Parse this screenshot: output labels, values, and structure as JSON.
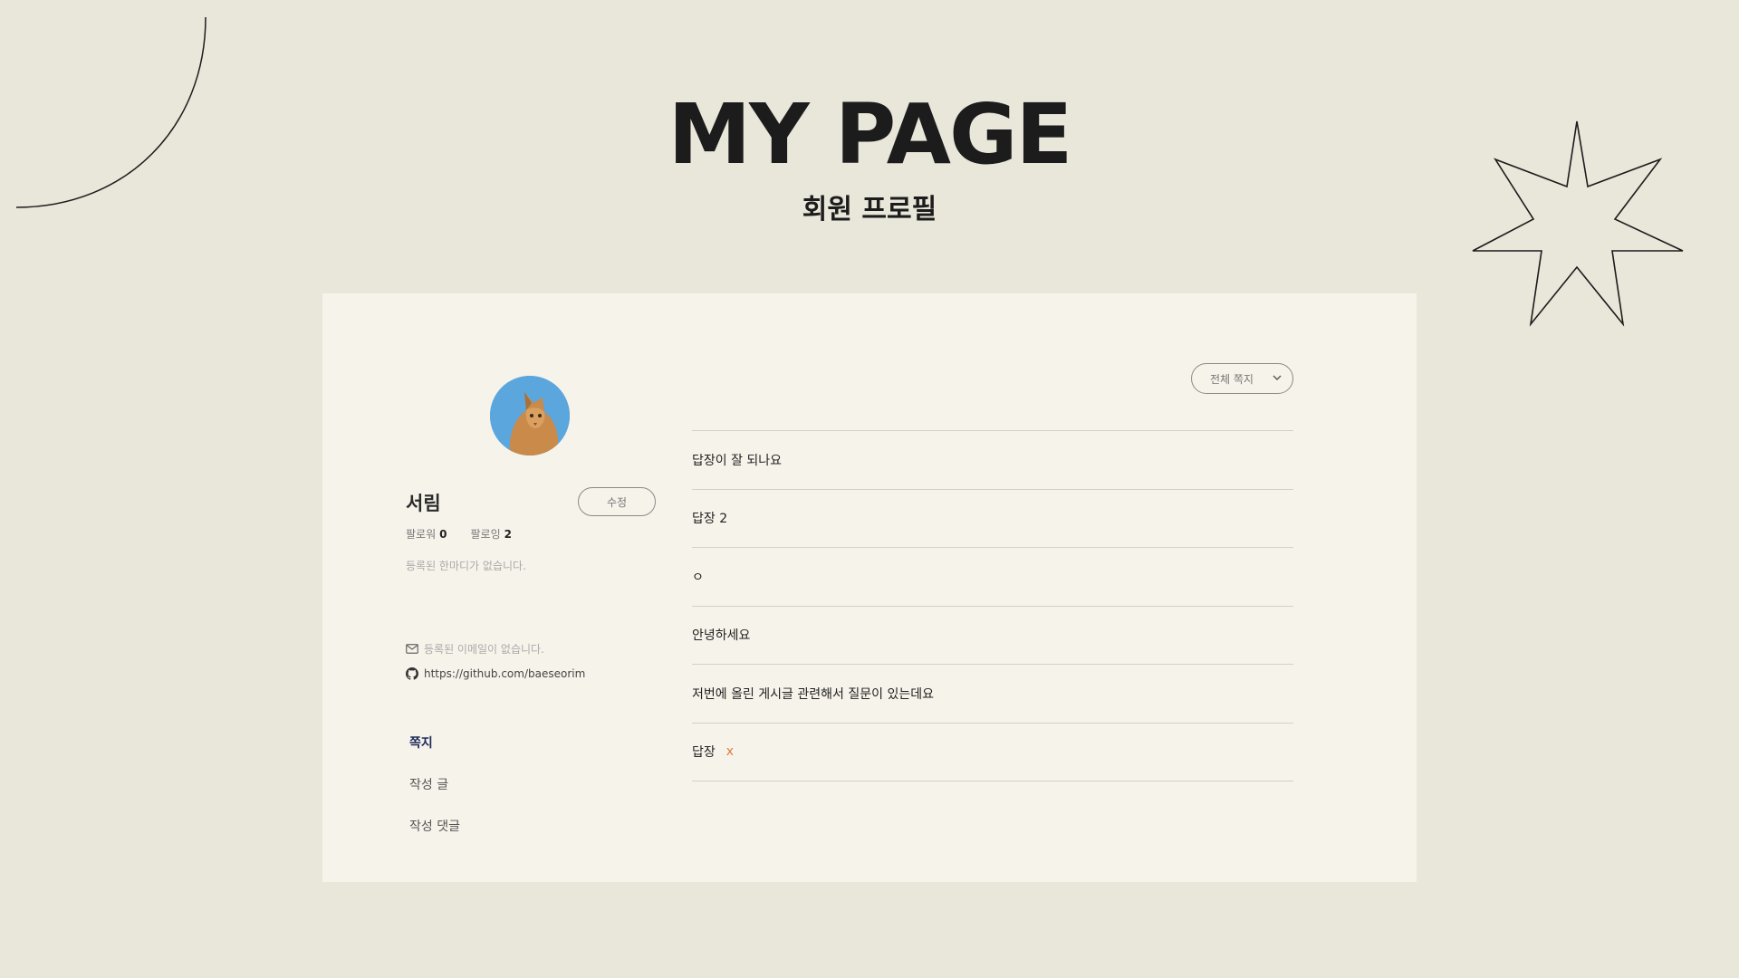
{
  "header": {
    "title": "MY PAGE",
    "subtitle": "회원 프로필"
  },
  "profile": {
    "name": "서림",
    "edit_label": "수정",
    "followers_label": "팔로워",
    "followers_count": "0",
    "following_label": "팔로잉",
    "following_count": "2",
    "bio": "등록된 한마디가 없습니다.",
    "email": "등록된 이메일이 없습니다.",
    "github": "https://github.com/baeseorim"
  },
  "nav": {
    "items": [
      "쪽지",
      "작성 글",
      "작성 댓글"
    ],
    "active": "쪽지"
  },
  "filter": {
    "selected": "전체 쪽지"
  },
  "messages": [
    {
      "text": "답장이 잘 되나요"
    },
    {
      "text": "답장 2"
    },
    {
      "text": "ㅇ"
    },
    {
      "text": "안녕하세요"
    },
    {
      "text": "저번에 올린 게시글 관련해서 질문이 있는데요"
    },
    {
      "text": "답장",
      "mark": "x"
    }
  ],
  "colors": {
    "background": "#e9e6da",
    "card": "#f6f3ea",
    "accent_nav": "#1f2a5a",
    "x_mark": "#e07a3f"
  }
}
